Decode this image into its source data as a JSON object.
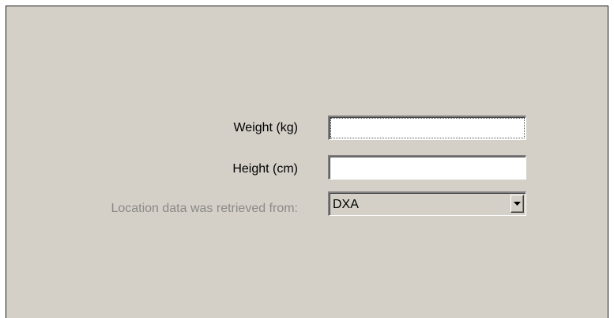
{
  "form": {
    "weight": {
      "label": "Weight (kg)",
      "value": ""
    },
    "height": {
      "label": "Height (cm)",
      "value": ""
    },
    "location": {
      "label": "Location data was retrieved from:",
      "selected": "DXA",
      "arrow_icon": "chevron-down-icon"
    }
  },
  "colors": {
    "panel_background": "#d4d0c8",
    "disabled_text": "#8c8a86",
    "input_background": "#ffffff"
  }
}
